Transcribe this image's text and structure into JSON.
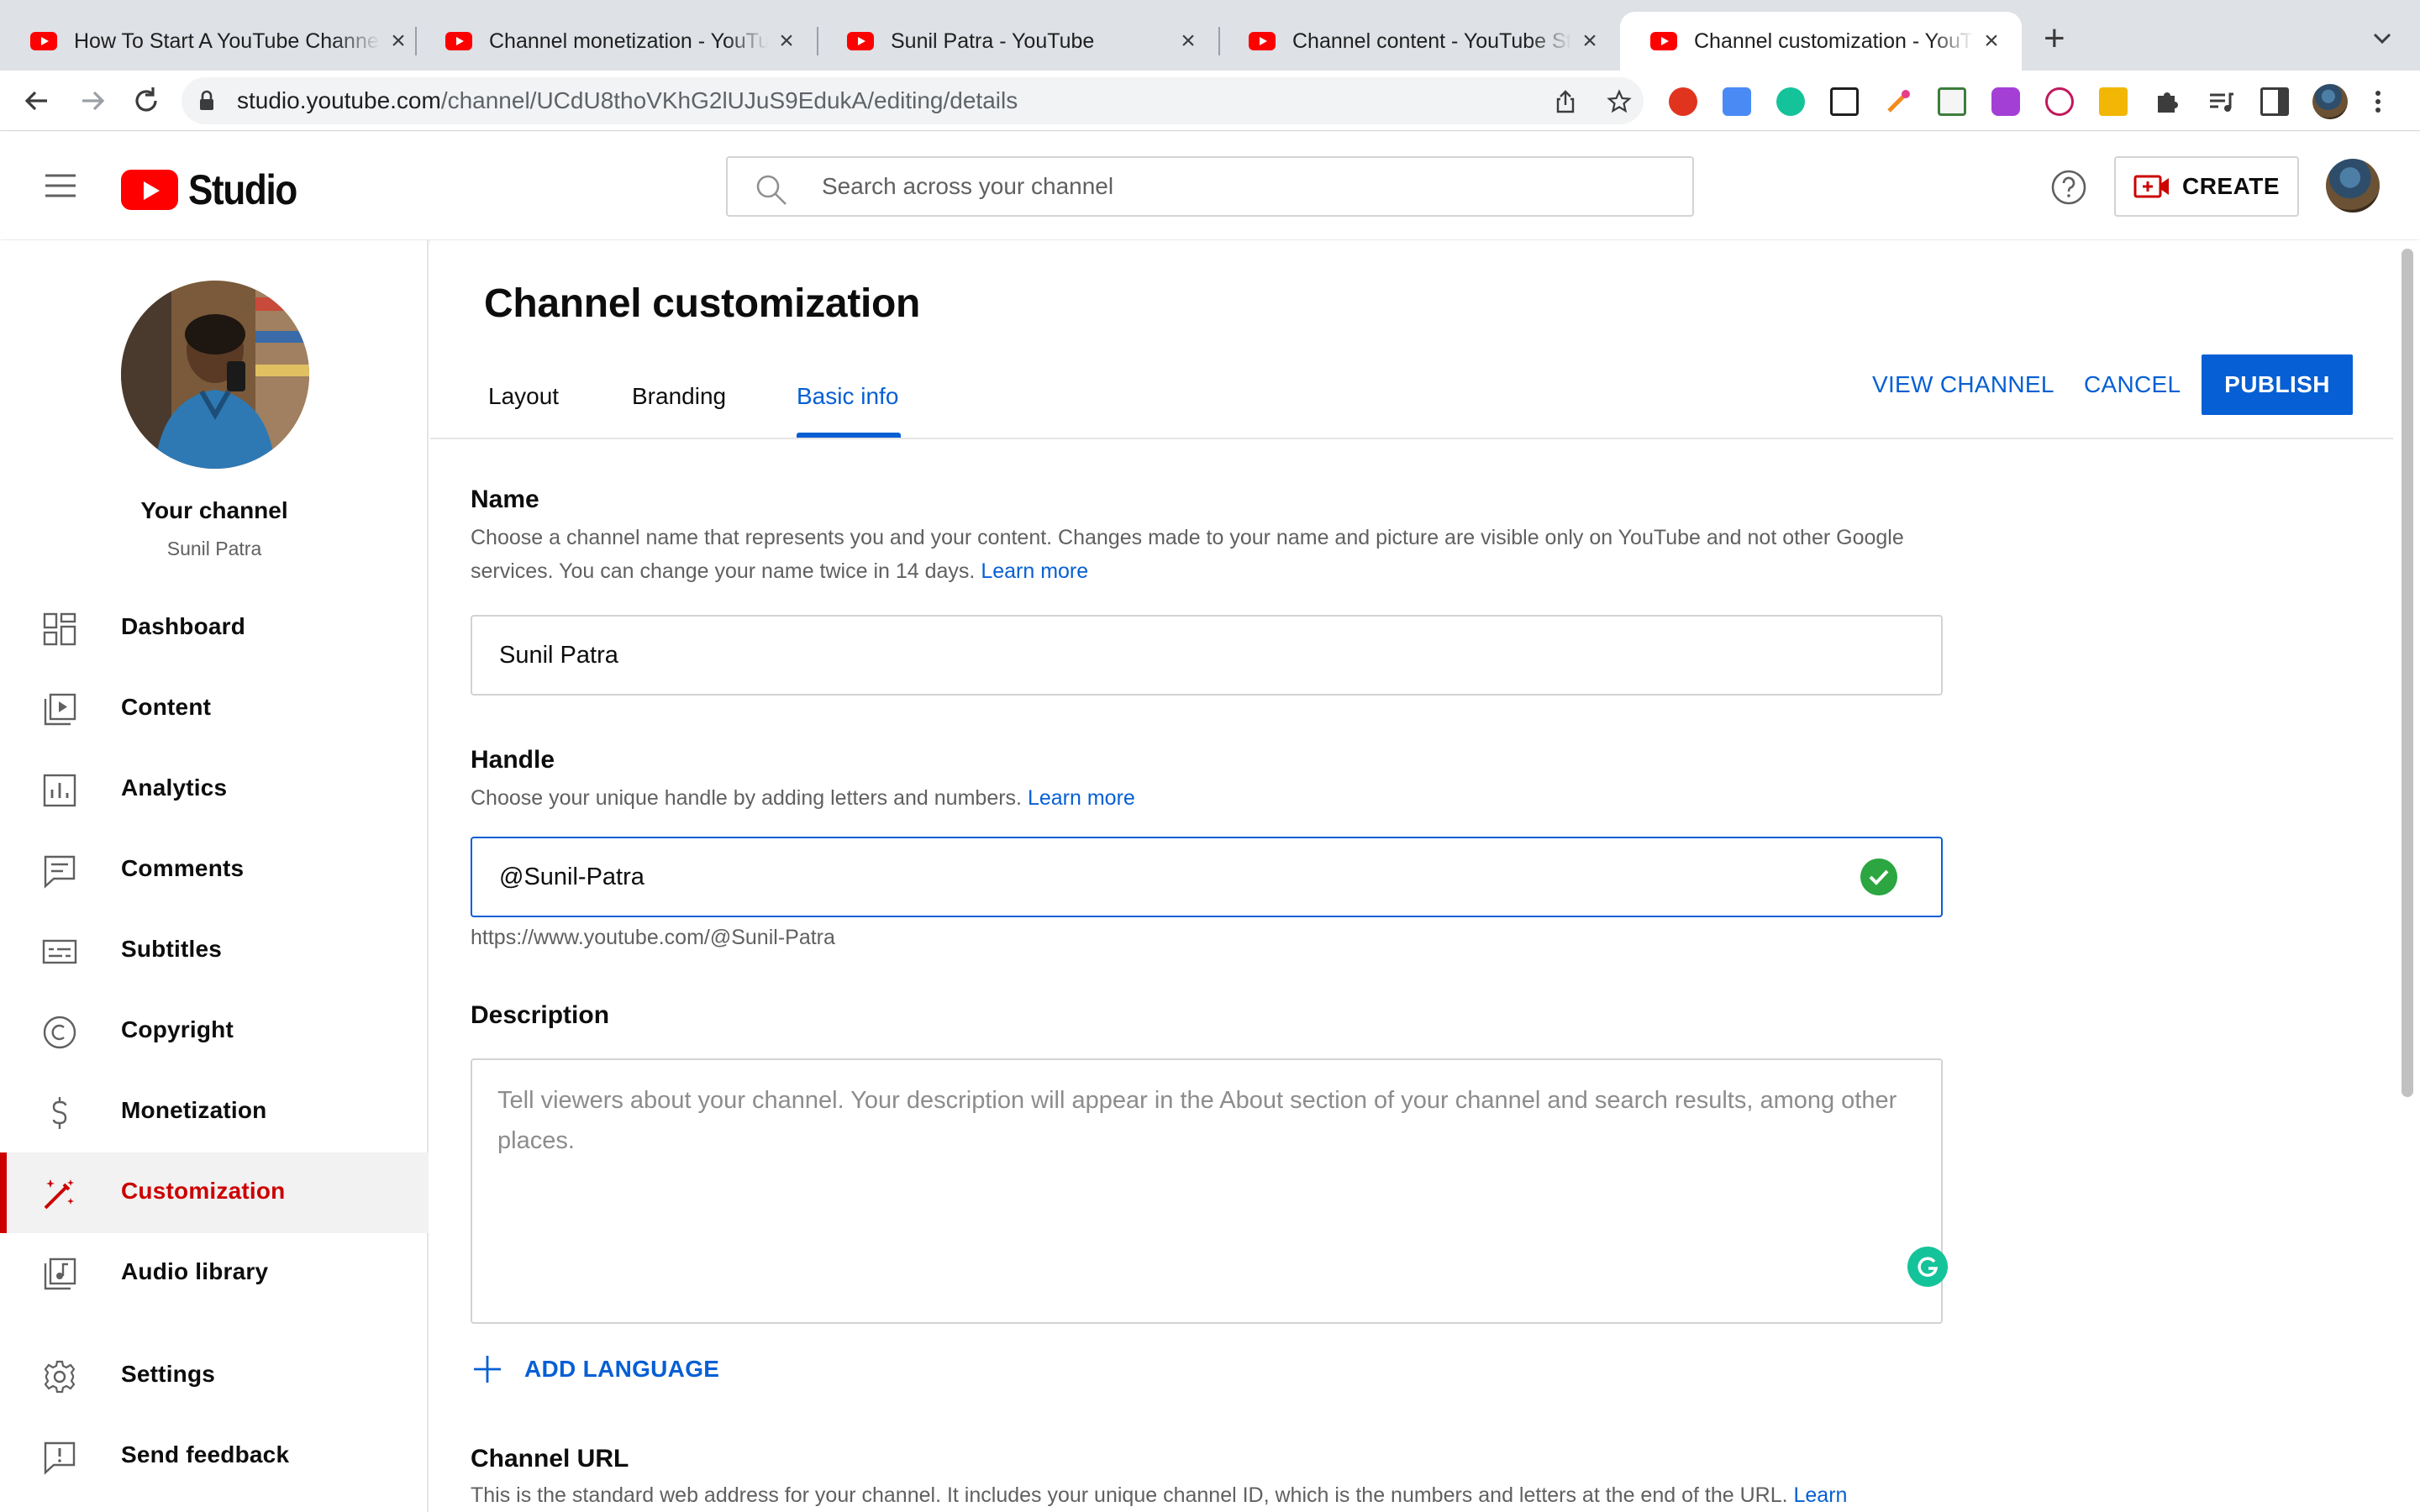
{
  "browser": {
    "tabs": [
      {
        "title": "How To Start A YouTube Channel"
      },
      {
        "title": "Channel monetization - YouTube Studio"
      },
      {
        "title": "Sunil Patra - YouTube"
      },
      {
        "title": "Channel content - YouTube Studio"
      },
      {
        "title": "Channel customization - YouTube Studio",
        "active": true
      }
    ],
    "address": {
      "host": "studio.youtube.com",
      "path": "/channel/UCdU8thoVKhG2lUJuS9EdukA/editing/details"
    }
  },
  "header": {
    "logo_text": "Studio",
    "search_placeholder": "Search across your channel",
    "create_label": "CREATE"
  },
  "sidebar": {
    "channel_title": "Your channel",
    "channel_name": "Sunil Patra",
    "items": [
      {
        "label": "Dashboard",
        "icon": "dashboard-icon"
      },
      {
        "label": "Content",
        "icon": "content-icon"
      },
      {
        "label": "Analytics",
        "icon": "analytics-icon"
      },
      {
        "label": "Comments",
        "icon": "comments-icon"
      },
      {
        "label": "Subtitles",
        "icon": "subtitles-icon"
      },
      {
        "label": "Copyright",
        "icon": "copyright-icon"
      },
      {
        "label": "Monetization",
        "icon": "monetization-icon"
      },
      {
        "label": "Customization",
        "icon": "customization-icon",
        "active": true
      },
      {
        "label": "Audio library",
        "icon": "audio-library-icon"
      },
      {
        "label": "Settings",
        "icon": "gear-icon"
      },
      {
        "label": "Send feedback",
        "icon": "feedback-icon"
      }
    ]
  },
  "main": {
    "title": "Channel customization",
    "tabs": [
      {
        "label": "Layout"
      },
      {
        "label": "Branding"
      },
      {
        "label": "Basic info",
        "active": true
      }
    ],
    "actions": {
      "view_channel": "VIEW CHANNEL",
      "cancel": "CANCEL",
      "publish": "PUBLISH"
    },
    "name_section": {
      "title": "Name",
      "description": "Choose a channel name that represents you and your content. Changes made to your name and picture are visible only on YouTube and not other Google services. You can change your name twice in 14 days.",
      "learn_more": "Learn more",
      "value": "Sunil Patra"
    },
    "handle_section": {
      "title": "Handle",
      "description": "Choose your unique handle by adding letters and numbers.",
      "learn_more": "Learn more",
      "value": "@Sunil-Patra",
      "url": "https://www.youtube.com/@Sunil-Patra"
    },
    "description_section": {
      "title": "Description",
      "placeholder": "Tell viewers about your channel. Your description will appear in the About section of your channel and search results, among other places.",
      "add_language": "ADD LANGUAGE"
    },
    "channel_url_section": {
      "title": "Channel URL",
      "description": "This is the standard web address for your channel. It includes your unique channel ID, which is the numbers and letters at the end of the URL.",
      "learn_more": "Learn"
    }
  },
  "colors": {
    "accent": "#065fd4",
    "brand_red": "#ff0000",
    "active_nav": "#cc0000",
    "success": "#2ba640"
  }
}
